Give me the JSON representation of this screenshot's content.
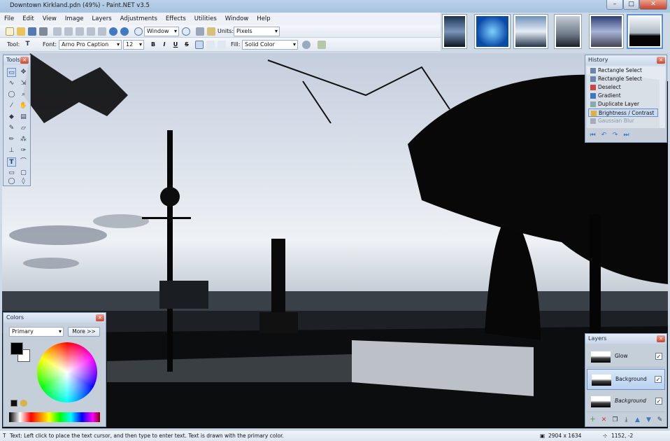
{
  "window": {
    "title": "Downtown Kirkland.pdn (49%) - Paint.NET v3.5",
    "min_glyph": "–",
    "max_glyph": "□",
    "close_glyph": "✕"
  },
  "menu": [
    "File",
    "Edit",
    "View",
    "Image",
    "Layers",
    "Adjustments",
    "Effects",
    "Utilities",
    "Window",
    "Help"
  ],
  "toolbar": {
    "zoom_mode": "Window",
    "units_label": "Units:",
    "units_value": "Pixels",
    "tool_label": "Tool:",
    "font_label": "Font:",
    "font_value": "Arno Pro Caption",
    "font_size": "12",
    "bold": "B",
    "italic": "I",
    "underline": "U",
    "strike": "S",
    "fill_label": "Fill:",
    "fill_value": "Solid Color"
  },
  "tools_panel": {
    "title": "Tools",
    "close_glyph": "✕"
  },
  "history_panel": {
    "title": "History",
    "close_glyph": "✕",
    "items": [
      "Rectangle Select",
      "Rectangle Select",
      "Deselect",
      "Gradient",
      "Duplicate Layer",
      "Brightness / Contrast",
      "Gaussian Blur"
    ],
    "selected_index": 5
  },
  "colors_panel": {
    "title": "Colors",
    "close_glyph": "✕",
    "mode": "Primary",
    "more_button": "More >>"
  },
  "layers_panel": {
    "title": "Layers",
    "close_glyph": "✕",
    "layers": [
      {
        "name": "Glow",
        "visible_mark": "✓"
      },
      {
        "name": "Background",
        "visible_mark": "✓"
      },
      {
        "name": "Background",
        "visible_mark": "✓"
      }
    ]
  },
  "status": {
    "hint": "Text: Left click to place the text cursor, and then type to enter text. Text is drawn with the primary color.",
    "image_size": "2904 x 1634",
    "cursor_pos": "1152, -2"
  },
  "colors": {
    "accent": "#3b78c2",
    "selection": "#c9dbf2"
  }
}
